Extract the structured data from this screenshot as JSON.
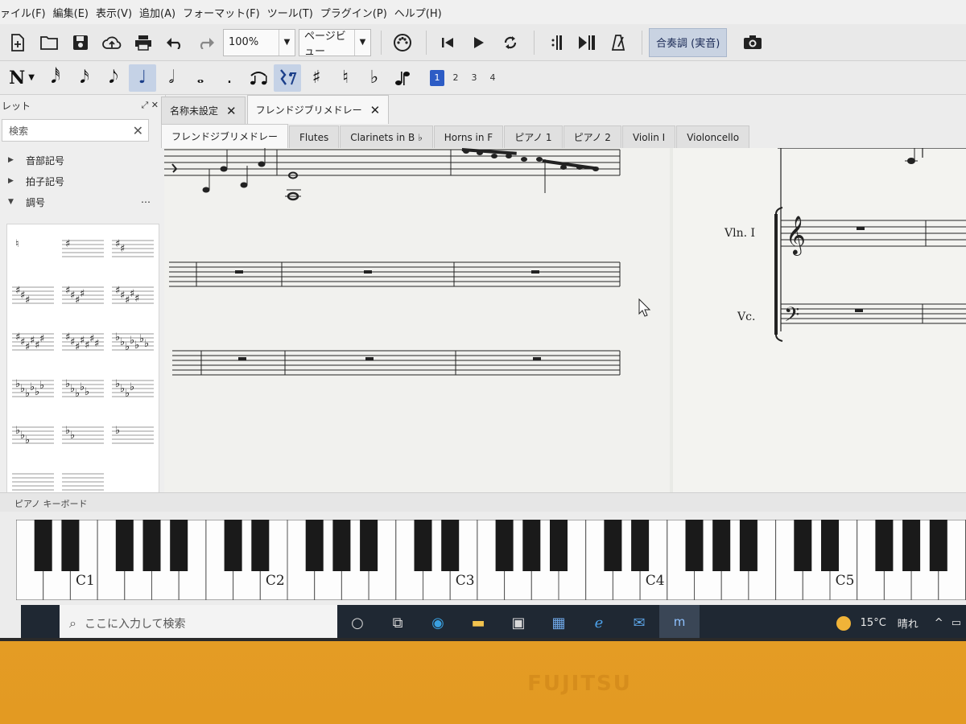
{
  "menu": [
    "ァイル(F)",
    "編集(E)",
    "表示(V)",
    "追加(A)",
    "フォーマット(F)",
    "ツール(T)",
    "プラグイン(P)",
    "ヘルプ(H)"
  ],
  "toolbar": {
    "zoom": "100%",
    "view_mode": "ページビュー",
    "concert_pitch": "合奏調 (実音)"
  },
  "note_input": {
    "mode_glyph": "N",
    "voices": [
      "1",
      "2",
      "3",
      "4"
    ]
  },
  "palette": {
    "title": "レット",
    "search_placeholder": "検索",
    "sections": [
      "音部記号",
      "拍子記号",
      "調号"
    ],
    "more": "⋯"
  },
  "score_tabs": [
    {
      "label": "名称未設定",
      "close": "✕"
    },
    {
      "label": "フレンドジブリメドレー",
      "close": "✕"
    }
  ],
  "part_tabs": [
    "フレンドジブリメドレー",
    "Flutes",
    "Clarinets in B ♭",
    "Horns in F",
    "ピアノ 1",
    "ピアノ 2",
    "Violin I",
    "Violoncello"
  ],
  "score": {
    "instrument_labels": [
      "Vln. I",
      "Vc."
    ]
  },
  "keyboard": {
    "title": "ピアノ キーボード",
    "octave_labels": [
      "C1",
      "C2",
      "C3",
      "C4",
      "C5"
    ]
  },
  "taskbar": {
    "search_placeholder": "ここに入力して検索",
    "temperature": "15°C",
    "weather": "晴れ",
    "tray_arrow": "^"
  },
  "brand": "FUJITSU",
  "colors": {
    "bezel": "#e8a32a",
    "accent": "#2d5cc5",
    "taskbar": "#1f2833"
  }
}
